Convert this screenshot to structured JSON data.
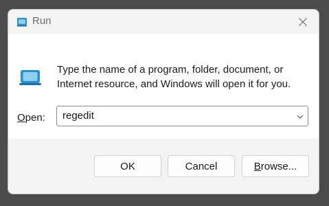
{
  "window": {
    "title": "Run",
    "close_icon": "close-icon"
  },
  "content": {
    "icon": "run-icon",
    "description": "Type the name of a program, folder, document, or Internet resource, and Windows will open it for you.",
    "open_label_prefix": "O",
    "open_label_rest": "pen:",
    "open_value": "regedit"
  },
  "buttons": {
    "ok": "OK",
    "cancel": "Cancel",
    "browse_prefix": "B",
    "browse_rest": "rowse..."
  },
  "colors": {
    "accent": "#2a8fd0",
    "icon_light": "#8fd0f2"
  }
}
